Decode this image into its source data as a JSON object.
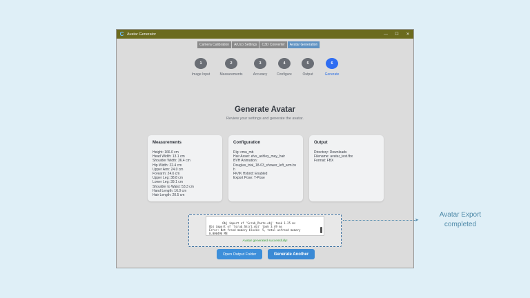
{
  "window": {
    "title": "Avatar Generator",
    "app_icon": "app-logo-icon",
    "controls": {
      "minimize": "—",
      "maximize": "☐",
      "close": "✕"
    }
  },
  "tabs": [
    {
      "label": "Camera Calibration",
      "active": false
    },
    {
      "label": "ArUco Settings",
      "active": false
    },
    {
      "label": "C3D Converter",
      "active": false
    },
    {
      "label": "Avatar Generation",
      "active": true
    }
  ],
  "steps": [
    {
      "num": "1",
      "label": "Image Input"
    },
    {
      "num": "2",
      "label": "Measurements"
    },
    {
      "num": "3",
      "label": "Accuracy"
    },
    {
      "num": "4",
      "label": "Configure"
    },
    {
      "num": "5",
      "label": "Output"
    },
    {
      "num": "6",
      "label": "Generate",
      "active": true
    }
  ],
  "page": {
    "title": "Generate Avatar",
    "subtitle": "Review your settings and generate the avatar."
  },
  "cards": {
    "measurements": {
      "title": "Measurements",
      "lines": [
        "Height: 166.0 cm",
        "Head Width: 13.1 cm",
        "Shoulder Width: 36.4 cm",
        "Hip Width: 22.4 cm",
        "Upper Arm: 24.0 cm",
        "Forearm: 24.6 cm",
        "Upper Leg: 38.8 cm",
        "Lower Leg: 39.1 cm",
        "Shoulder to Waist: 53.3 cm",
        "Hand Length: 16.0 cm",
        "Hair Length: 20.5 cm"
      ]
    },
    "configuration": {
      "title": "Configuration",
      "lines": [
        "Rig: cmu_mb",
        "Hair Asset: elvs_ashley_may_hair",
        "BVH Animation:",
        "Douglas_trial_18-03_shower_left_arm.bv",
        "h",
        "FK/IK Hybrid: Enabled",
        "Export Pose: T-Pose"
      ]
    },
    "output": {
      "title": "Output",
      "lines": [
        "Directory: Downloads",
        "Filename: avatar_test.fbx",
        "Format: FBX"
      ]
    }
  },
  "log": {
    "text": "Obj import of 'Scrub_Pants.obj' took 1.25 ms\nObj import of 'Scrub_Shirt.obj' took 3.49 ms\nError: Not freed memory blocks: 5, total unfreed memory\n0.000496 MB",
    "status": "Avatar generated successfully!"
  },
  "buttons": {
    "open_folder": "Open Output Folder",
    "generate_another": "Generate Another"
  },
  "callout": {
    "text": "Avatar Export completed"
  }
}
